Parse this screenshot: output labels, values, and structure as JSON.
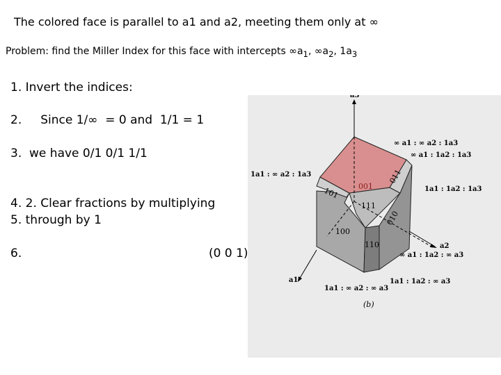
{
  "title": "The colored face is parallel to a1 and a2, meeting them only at ∞",
  "problem": {
    "text": "Problem: find the Miller Index for this face with intercepts ∞a",
    "sub1": "1",
    "sep1": ", ∞a",
    "sub2": "2",
    "sep2": ", 1a",
    "sub3": "3"
  },
  "steps": [
    "1. Invert the indices:",
    "2.     Since 1/∞  = 0 and  1/1 = 1",
    "3.  we have 0/1 0/1 1/1",
    "4. 2. Clear fractions by multiplying",
    "5. through by 1",
    "6.",
    "(0 0 1)"
  ],
  "figure": {
    "caption": "(b)",
    "axes": [
      "a3",
      "a2",
      "a1"
    ],
    "faces": [
      "001",
      "101",
      "011",
      "111",
      "100",
      "110",
      "010"
    ],
    "labels": [
      "∞ a1 : ∞ a2 : 1a3",
      "∞ a1 : 1a2 : 1a3",
      "1a1 : ∞ a2 : 1a3",
      "1a1 : 1a2 : 1a3",
      "∞ a1 : 1a2 : ∞ a3",
      "1a1 : 1a2 : ∞ a3",
      "1a1 : ∞ a2 : ∞ a3"
    ],
    "highlight_color": "#d98f8f"
  }
}
